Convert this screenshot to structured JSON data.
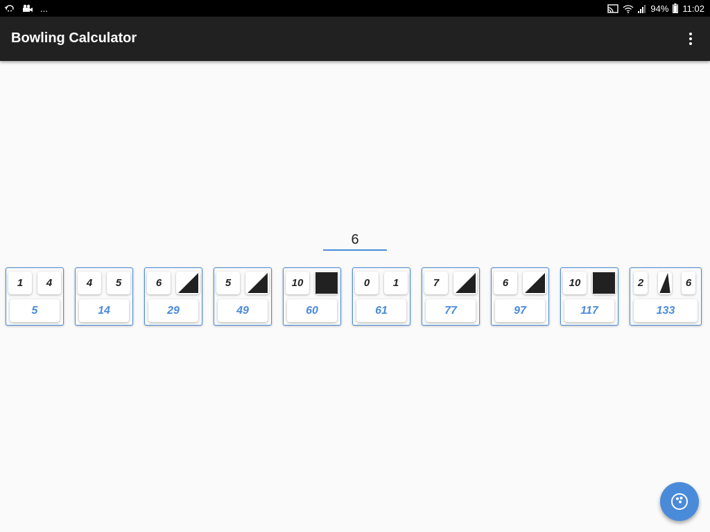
{
  "status_bar": {
    "left_icons": [
      "rotate-icon",
      "video-camera-icon"
    ],
    "more": "...",
    "right_icons": [
      "cast-icon",
      "wifi-icon",
      "signal-icon",
      "battery-icon"
    ],
    "battery": "94%",
    "time": "11:02"
  },
  "app_bar": {
    "title": "Bowling Calculator",
    "menu_icon": "more-vert-icon"
  },
  "pin_input": {
    "value": "6"
  },
  "frames": [
    {
      "balls": [
        {
          "text": "1"
        },
        {
          "text": "4"
        }
      ],
      "total": "5"
    },
    {
      "balls": [
        {
          "text": "4"
        },
        {
          "text": "5"
        }
      ],
      "total": "14"
    },
    {
      "balls": [
        {
          "text": "6"
        },
        {
          "text": "",
          "mark": "spare"
        }
      ],
      "total": "29"
    },
    {
      "balls": [
        {
          "text": "5"
        },
        {
          "text": "",
          "mark": "spare"
        }
      ],
      "total": "49"
    },
    {
      "balls": [
        {
          "text": "10"
        },
        {
          "text": "",
          "mark": "strike"
        }
      ],
      "total": "60"
    },
    {
      "balls": [
        {
          "text": "0"
        },
        {
          "text": "1"
        }
      ],
      "total": "61"
    },
    {
      "balls": [
        {
          "text": "7"
        },
        {
          "text": "",
          "mark": "spare"
        }
      ],
      "total": "77"
    },
    {
      "balls": [
        {
          "text": "6"
        },
        {
          "text": "",
          "mark": "spare"
        }
      ],
      "total": "97"
    },
    {
      "balls": [
        {
          "text": "10"
        },
        {
          "text": "",
          "mark": "strike"
        }
      ],
      "total": "117"
    },
    {
      "balls": [
        {
          "text": "2"
        },
        {
          "text": "",
          "mark": "spare"
        },
        {
          "text": "6"
        }
      ],
      "total": "133"
    }
  ],
  "fab": {
    "icon": "bowling-ball-icon"
  },
  "colors": {
    "accent": "#4a8bd9",
    "app_bar": "#212121",
    "mark": "#212121"
  }
}
